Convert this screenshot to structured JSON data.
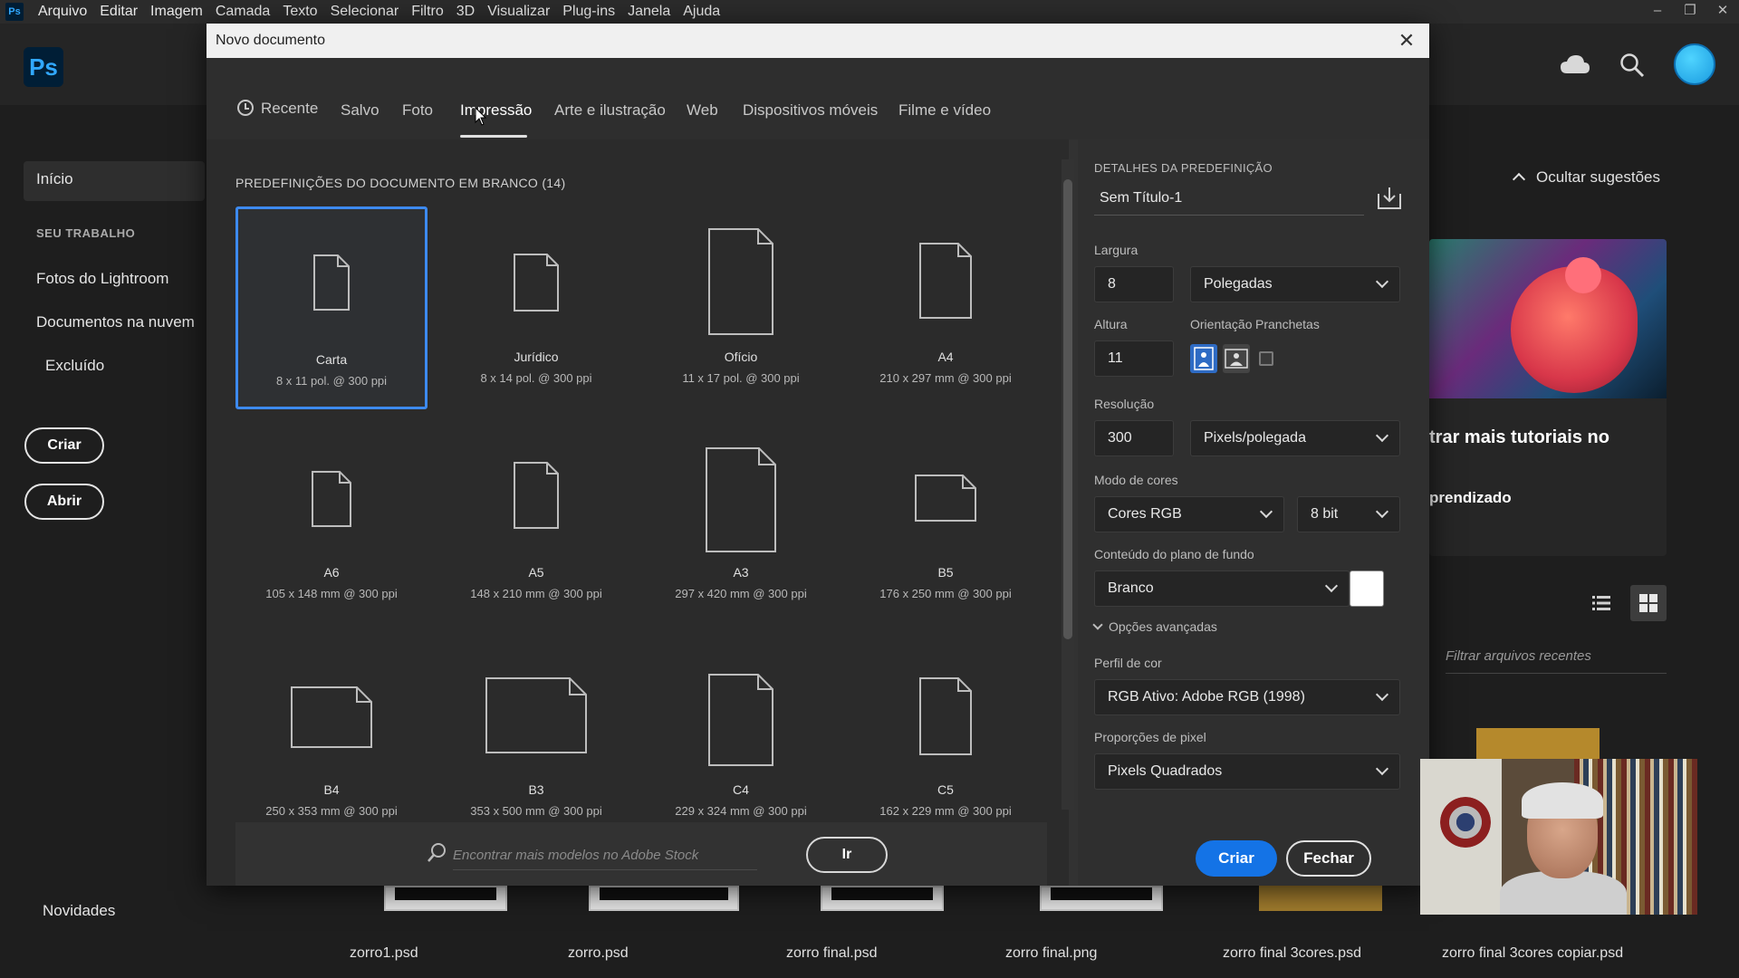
{
  "menubar": {
    "app_icon": "Ps",
    "items": [
      "Arquivo",
      "Editar",
      "Imagem",
      "Camada",
      "Texto",
      "Selecionar",
      "Filtro",
      "3D",
      "Visualizar",
      "Plug-ins",
      "Janela",
      "Ajuda"
    ]
  },
  "home": {
    "logo": "Ps",
    "header_icons": [
      "cloud-icon",
      "search-icon",
      "avatar"
    ],
    "sidebar": {
      "home": "Início",
      "section": "SEU TRABALHO",
      "items": [
        "Fotos do Lightroom",
        "Documentos na nuvem",
        "Excluído"
      ],
      "create_btn": "Criar",
      "open_btn": "Abrir",
      "news": "Novidades"
    },
    "suggestions": {
      "hide_label": "Ocultar sugestões",
      "card_title": "trar mais tutoriais no",
      "card_sub": "prendizado"
    },
    "filter_placeholder": "Filtrar arquivos recentes",
    "recent_files": [
      "zorro1.psd",
      "zorro.psd",
      "zorro final.psd",
      "zorro final.png",
      "zorro final 3cores.psd",
      "zorro final 3cores copiar.psd"
    ]
  },
  "dialog": {
    "title": "Novo documento",
    "tabs": [
      "Recente",
      "Salvo",
      "Foto",
      "Impressão",
      "Arte e ilustração",
      "Web",
      "Dispositivos móveis",
      "Filme e vídeo"
    ],
    "active_tab": "Impressão",
    "presets_header": "PREDEFINIÇÕES DO DOCUMENTO EM BRANCO",
    "presets_count": "(14)",
    "presets": [
      {
        "name": "Carta",
        "desc": "8 x 11 pol. @ 300 ppi",
        "selected": true
      },
      {
        "name": "Jurídico",
        "desc": "8 x 14 pol. @ 300 ppi"
      },
      {
        "name": "Ofício",
        "desc": "11 x 17 pol. @ 300 ppi"
      },
      {
        "name": "A4",
        "desc": "210 x 297 mm @ 300 ppi"
      },
      {
        "name": "A6",
        "desc": "105 x 148 mm @ 300 ppi"
      },
      {
        "name": "A5",
        "desc": "148 x 210 mm @ 300 ppi"
      },
      {
        "name": "A3",
        "desc": "297 x 420 mm @ 300 ppi"
      },
      {
        "name": "B5",
        "desc": "176 x 250 mm @ 300 ppi"
      },
      {
        "name": "B4",
        "desc": "250 x 353 mm @ 300 ppi"
      },
      {
        "name": "B3",
        "desc": "353 x 500 mm @ 300 ppi"
      },
      {
        "name": "C4",
        "desc": "229 x 324 mm @ 300 ppi"
      },
      {
        "name": "C5",
        "desc": "162 x 229 mm @ 300 ppi"
      }
    ],
    "stock_placeholder": "Encontrar mais modelos no Adobe Stock",
    "stock_btn": "Ir",
    "details": {
      "header": "DETALHES DA PREDEFINIÇÃO",
      "doc_title": "Sem Título-1",
      "width_label": "Largura",
      "width_value": "8",
      "width_unit": "Polegadas",
      "height_label": "Altura",
      "height_value": "11",
      "orientation_label": "Orientação",
      "artboards_label": "Pranchetas",
      "resolution_label": "Resolução",
      "resolution_value": "300",
      "resolution_unit": "Pixels/polegada",
      "color_mode_label": "Modo de cores",
      "color_mode": "Cores RGB",
      "bit_depth": "8 bit",
      "background_label": "Conteúdo do plano de fundo",
      "background": "Branco",
      "background_color": "#ffffff",
      "advanced": "Opções avançadas",
      "color_profile_label": "Perfil de cor",
      "color_profile": "RGB Ativo: Adobe RGB (1998)",
      "pixel_aspect_label": "Proporções de pixel",
      "pixel_aspect": "Pixels Quadrados",
      "create_btn": "Criar",
      "close_btn": "Fechar"
    }
  },
  "colors": {
    "accent": "#1473e6",
    "selection": "#3d8aef"
  }
}
